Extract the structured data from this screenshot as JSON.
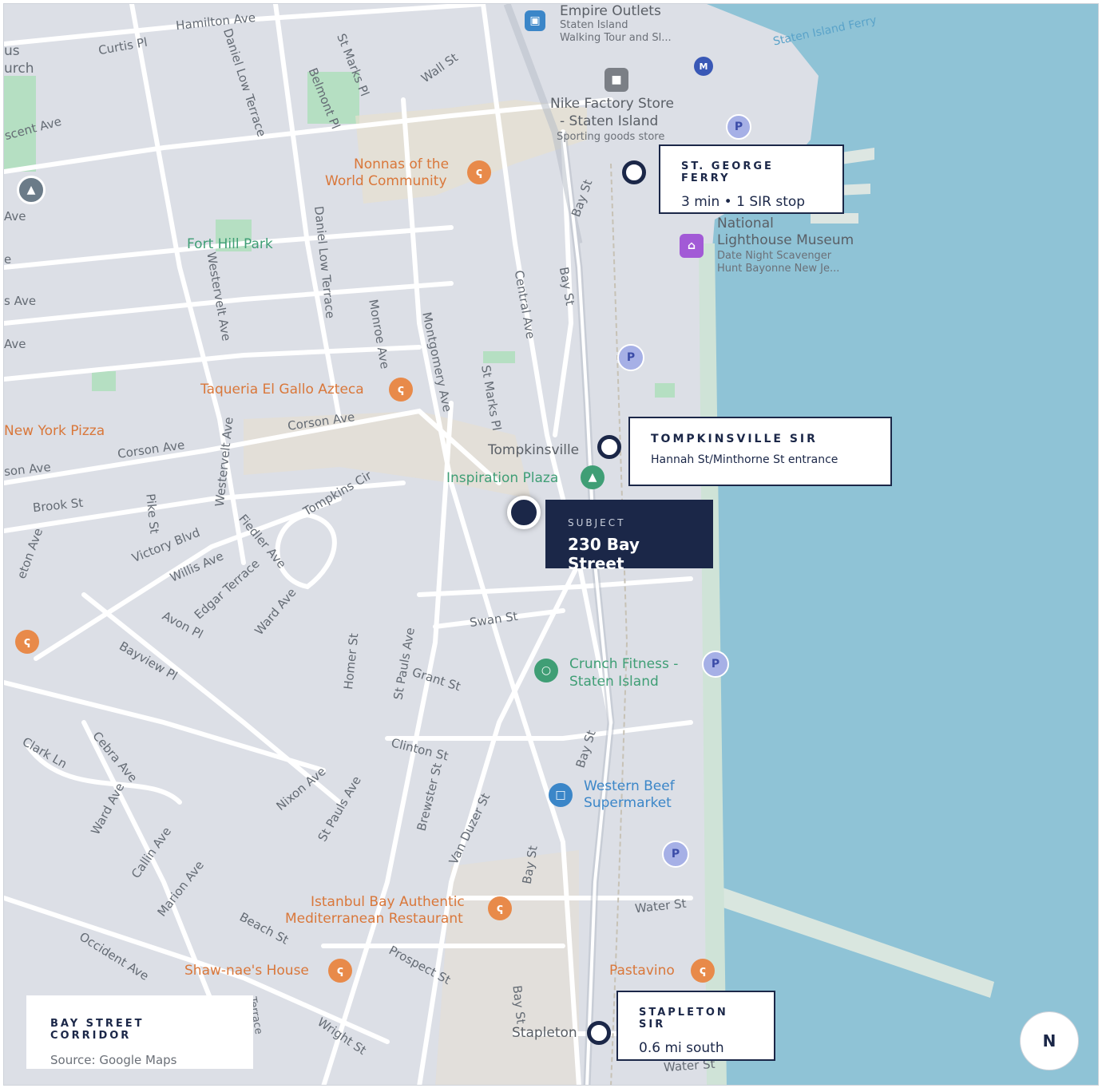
{
  "map": {
    "streets": {
      "hamilton_ave": "Hamilton Ave",
      "curtis_pl": "Curtis Pl",
      "daniel_low_terrace_1": "Daniel Low Terrace",
      "st_marks_pl_1": "St Marks Pl",
      "belmont_pl": "Belmont Pl",
      "wall_st": "Wall St",
      "crescent_ave": "scent Ave",
      "ave_1": "Ave",
      "ave_2": "e",
      "s_ave": "s Ave",
      "ave_3": "Ave",
      "daniel_low_terrace_2": "Daniel Low Terrace",
      "westervelt_ave_1": "Westervelt Ave",
      "monroe_ave": "Monroe Ave",
      "montgomery_ave": "Montgomery Ave",
      "central_ave": "Central Ave",
      "bay_st_1": "Bay St",
      "bay_st_2": "Bay St",
      "st_marks_pl_2": "St Marks Pl",
      "corson_ave_1": "Corson Ave",
      "corson_ave_2": "Corson Ave",
      "corson_ave_3": "son Ave",
      "westervelt_ave_2": "Westervelt Ave",
      "brook_st": "Brook St",
      "pike_st": "Pike St",
      "tompkins_cir": "Tompkins Cir",
      "victory_blvd": "Victory Blvd",
      "willis_ave": "Willis Ave",
      "fiedler_ave": "Fiedler Ave",
      "edgar_terrace": "Edgar Terrace",
      "avon_pl": "Avon Pl",
      "ward_ave_1": "Ward Ave",
      "swan_st": "Swan St",
      "bayview_pl": "Bayview Pl",
      "homer_st": "Homer St",
      "st_pauls_ave_1": "St Pauls Ave",
      "grant_st": "Grant St",
      "clinton_st": "Clinton St",
      "bay_st_3": "Bay St",
      "clark_ln": "Clark Ln",
      "cebra_ave": "Cebra Ave",
      "ward_ave_2": "Ward Ave",
      "nixon_ave": "Nixon Ave",
      "st_pauls_ave_2": "St Pauls Ave",
      "brewster_st": "Brewster St",
      "van_duzer_st": "Van Duzer St",
      "callin_ave": "Callin Ave",
      "marion_ave": "Marion Ave",
      "beach_st": "Beach St",
      "bay_st_4": "Bay St",
      "water_st_1": "Water St",
      "occident_ave": "Occident Ave",
      "prospect_st": "Prospect St",
      "bay_st_5": "Bay St",
      "wright_st": "Wright St",
      "water_st_2": "Water St",
      "edge_1": "us",
      "edge_2": "urch",
      "edge_3": "eton Ave",
      "terrace_edge": "Terrace",
      "staten_island_ferry": "Staten Island Ferry",
      "tompkinsville": "Tompkinsville",
      "stapleton": "Stapleton"
    },
    "pois": {
      "empire_outlets": "Empire Outlets",
      "empire_sub1": "Staten Island",
      "empire_sub2": "Walking Tour and Sl...",
      "nike_1": "Nike Factory Store",
      "nike_2": "- Staten Island",
      "nike_sub": "Sporting goods store",
      "nonnas_1": "Nonnas of the",
      "nonnas_2": "World Community",
      "fort_hill_park": "Fort Hill Park",
      "lighthouse_1": "National",
      "lighthouse_2": "Lighthouse Museum",
      "lighthouse_sub1": "Date Night Scavenger",
      "lighthouse_sub2": "Hunt Bayonne New Je...",
      "taqueria": "Taqueria El Gallo Azteca",
      "ny_pizza": "New York Pizza",
      "inspiration_plaza": "Inspiration Plaza",
      "crunch_1": "Crunch Fitness -",
      "crunch_2": "Staten Island",
      "western_beef_1": "Western Beef",
      "western_beef_2": "Supermarket",
      "istanbul_1": "Istanbul Bay Authentic",
      "istanbul_2": "Mediterranean Restaurant",
      "shawnaes": "Shaw-nae's House",
      "pastavino": "Pastavino",
      "parking": "P",
      "mta": "M"
    },
    "callouts": {
      "ferry_title": "ST. GEORGE FERRY",
      "ferry_sub": "3 min • 1 SIR stop",
      "tompkinsville_title": "TOMPKINSVILLE SIR",
      "tompkinsville_sub": "Hannah St/Minthorne St entrance",
      "subject_title": "SUBJECT",
      "subject_sub": "230 Bay Street",
      "stapleton_title": "STAPLETON SIR",
      "stapleton_sub": "0.6 mi south"
    },
    "legend": {
      "title": "BAY STREET CORRIDOR",
      "source": "Source: Google Maps"
    },
    "compass": "N",
    "colors": {
      "land": "#dcdfe6",
      "water": "#8fc3d6",
      "road": "#ffffff",
      "park": "#b5dfc2",
      "navy": "#1b2748"
    }
  }
}
